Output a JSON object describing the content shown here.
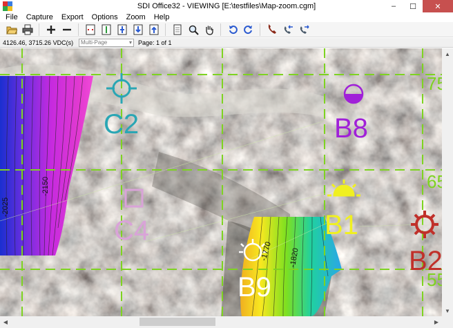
{
  "window": {
    "title": "SDI Office32 - VIEWING [E:\\testfiles\\Map-zoom.cgm]",
    "controls": {
      "minimize": "–",
      "maximize": "☐",
      "close": "✕"
    }
  },
  "menu": [
    {
      "label": "File"
    },
    {
      "label": "Capture"
    },
    {
      "label": "Export"
    },
    {
      "label": "Options"
    },
    {
      "label": "Zoom"
    },
    {
      "label": "Help"
    }
  ],
  "toolbar": {
    "buttons": [
      "open-folder-icon",
      "print-icon",
      "zoom-in-icon",
      "zoom-out-icon",
      "fit-width-icon",
      "fit-height-icon",
      "fit-page-icon",
      "page-down-icon",
      "page-up-icon",
      "page-view-icon",
      "magnifier-icon",
      "hand-pan-icon",
      "rotate-left-icon",
      "rotate-right-icon",
      "phone-icon",
      "phone-back-icon",
      "phone-forward-icon"
    ]
  },
  "status": {
    "coordinates": "4126.46, 3715.26  VDC(s)",
    "page_mode": "Multi-Page",
    "page_info": "Page: 1 of 1"
  },
  "map": {
    "labels": {
      "c2": "C2",
      "c4": "C4",
      "b8": "B8",
      "b1": "B1",
      "b9": "B9",
      "b2": "B2"
    },
    "contours": {
      "c1": "-2025",
      "c2": "-2150",
      "c3": "-1820",
      "c4": "-1770"
    },
    "edge_numbers": {
      "n1": "75",
      "n2": "65",
      "n3": "55"
    },
    "colors": {
      "grid": "#7ed321",
      "c_labels": "#2aa6b4",
      "c4_label": "#d9a3d8",
      "b8": "#a020d8",
      "b1": "#f0f020",
      "b2": "#c0302a",
      "b9": "#ffffff"
    }
  }
}
